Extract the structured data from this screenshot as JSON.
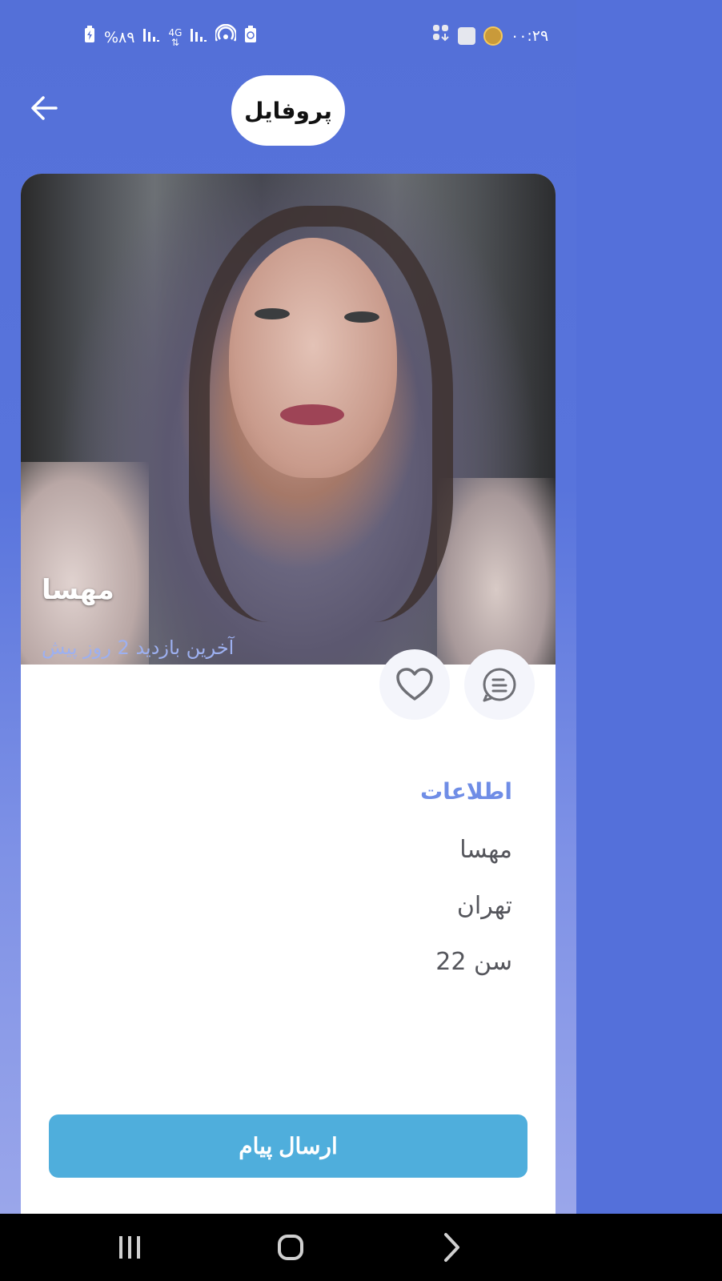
{
  "status_bar": {
    "battery": "%۸۹",
    "network": "4G",
    "time": "۰۰:۲۹"
  },
  "header": {
    "title": "پروفایل"
  },
  "profile": {
    "name": "مهسا",
    "last_seen": "آخرین بازدید 2 روز پیش"
  },
  "info": {
    "section_title": "اطلاعات",
    "name": "مهسا",
    "city": "تهران",
    "age": "سن 22"
  },
  "actions": {
    "send_message_label": "ارسال پیام"
  },
  "colors": {
    "background": "#5470d8",
    "card": "#ffffff",
    "accent_text": "#6f8de6",
    "send_button": "#4faedc",
    "nav_bar": "#000000"
  },
  "icons": {
    "back": "arrow-left-icon",
    "chat": "chat-bubble-icon",
    "like": "heart-outline-icon"
  }
}
